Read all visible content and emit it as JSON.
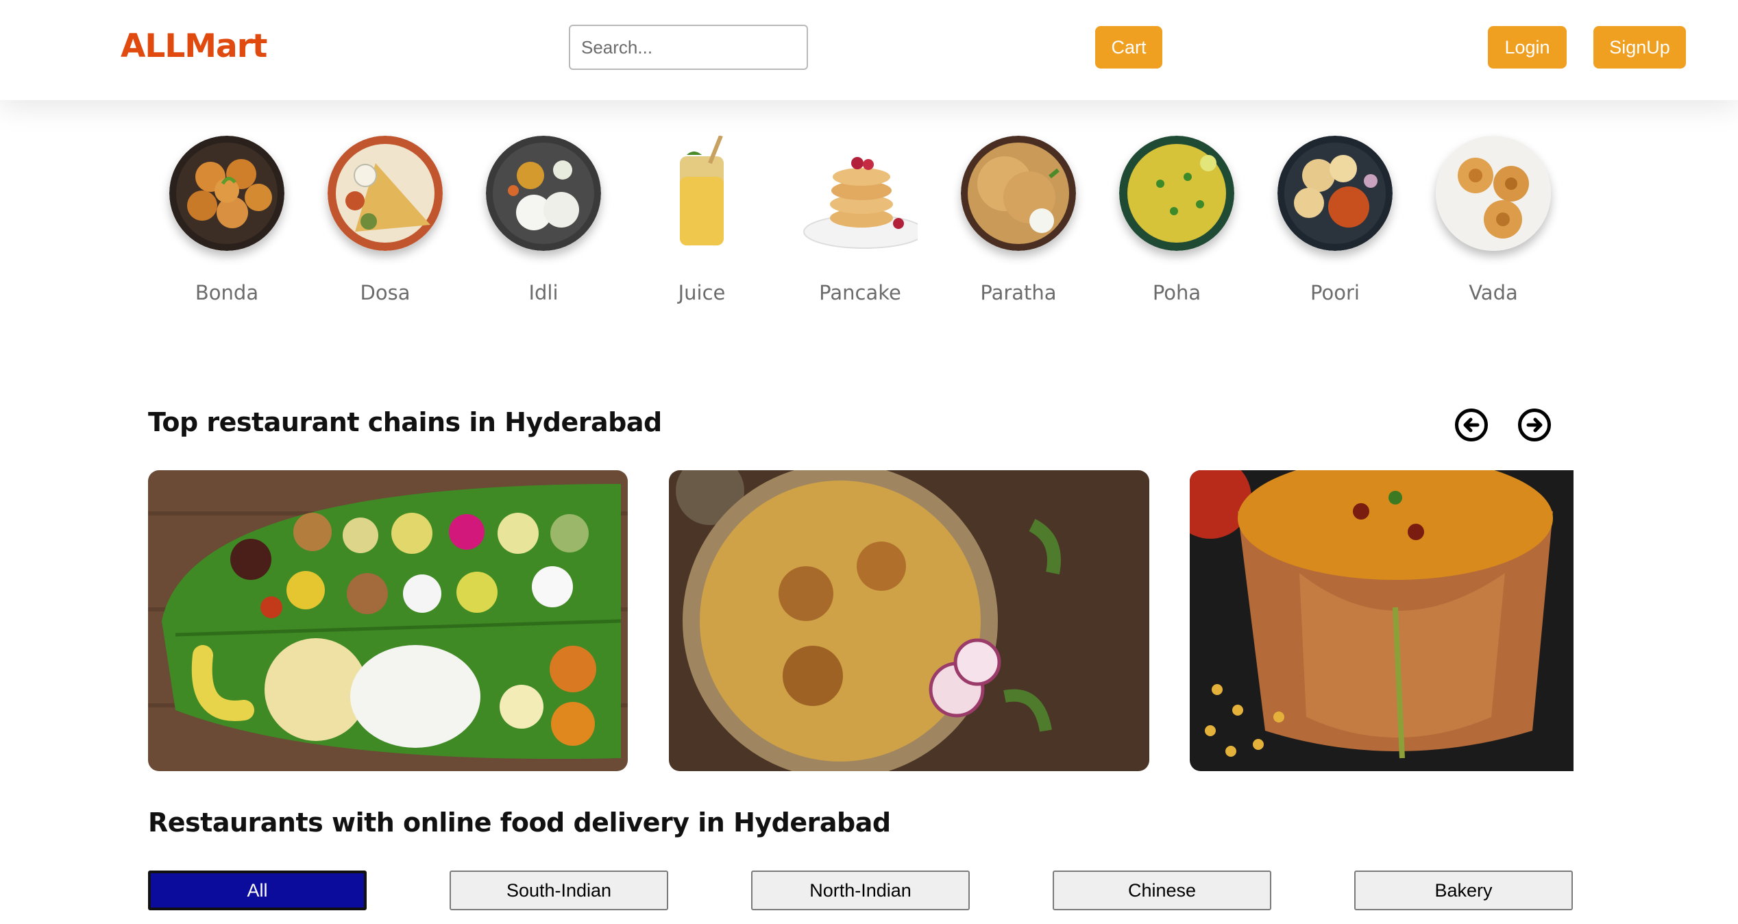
{
  "header": {
    "logo": "ALLMart",
    "search_placeholder": "Search...",
    "cart_label": "Cart",
    "login_label": "Login",
    "signup_label": "SignUp"
  },
  "categories": [
    {
      "label": "Bonda"
    },
    {
      "label": "Dosa"
    },
    {
      "label": "Idli"
    },
    {
      "label": "Juice"
    },
    {
      "label": "Pancake"
    },
    {
      "label": "Paratha"
    },
    {
      "label": "Poha"
    },
    {
      "label": "Poori"
    },
    {
      "label": "Vada"
    }
  ],
  "top_chains": {
    "title": "Top restaurant chains in Hyderabad",
    "prev_icon": "arrow-left-circle-icon",
    "next_icon": "arrow-right-circle-icon"
  },
  "delivery": {
    "title": "Restaurants with online food delivery in Hyderabad",
    "filters": [
      {
        "label": "All",
        "active": true
      },
      {
        "label": "South-Indian",
        "active": false
      },
      {
        "label": "North-Indian",
        "active": false
      },
      {
        "label": "Chinese",
        "active": false
      },
      {
        "label": "Bakery",
        "active": false
      }
    ]
  },
  "colors": {
    "brand": "#e04a0f",
    "button": "#f0a020",
    "active_filter": "#0b0b9c"
  }
}
